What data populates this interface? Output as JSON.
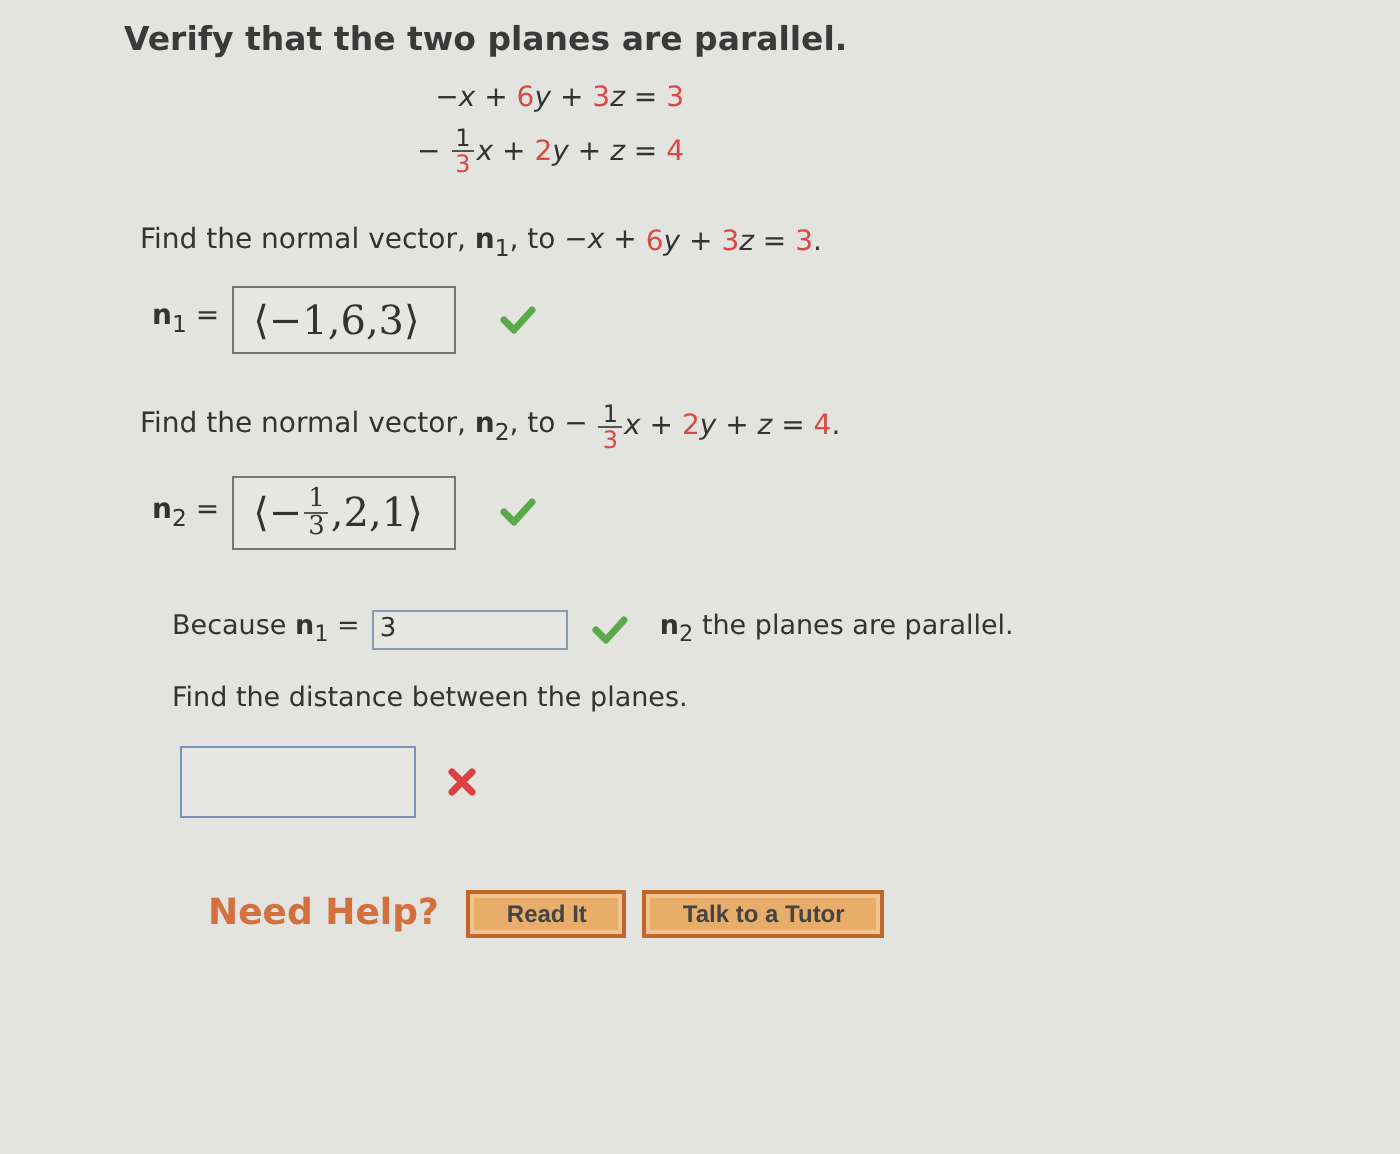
{
  "title": "Verify that the two planes are parallel.",
  "equations": [
    {
      "segments": [
        {
          "kind": "text",
          "text": "−*x* + ",
          "given": false
        },
        {
          "kind": "text",
          "text": "6",
          "given": true
        },
        {
          "kind": "text",
          "text": "*y* + ",
          "given": false
        },
        {
          "kind": "text",
          "text": "3",
          "given": true
        },
        {
          "kind": "text",
          "text": "*z* = ",
          "given": false
        },
        {
          "kind": "text",
          "text": "3",
          "given": true
        }
      ]
    },
    {
      "segments": [
        {
          "kind": "text",
          "text": "− ",
          "given": false
        },
        {
          "kind": "frac",
          "num": "1",
          "den": "3",
          "given": true
        },
        {
          "kind": "text",
          "text": "*x* + ",
          "given": false
        },
        {
          "kind": "text",
          "text": "2",
          "given": true
        },
        {
          "kind": "text",
          "text": "*y* + *z* = ",
          "given": false
        },
        {
          "kind": "text",
          "text": "4",
          "given": true
        }
      ]
    }
  ],
  "questions": [
    {
      "kind": "vector",
      "prompt": [
        {
          "kind": "text",
          "text": "Find the normal vector, **n**$_{1}$, to −*x* + ",
          "given": false
        },
        {
          "kind": "text",
          "text": "6",
          "given": true
        },
        {
          "kind": "text",
          "text": "*y* + ",
          "given": false
        },
        {
          "kind": "text",
          "text": "3",
          "given": true
        },
        {
          "kind": "text",
          "text": "*z* = ",
          "given": false
        },
        {
          "kind": "text",
          "text": "3",
          "given": true
        },
        {
          "kind": "text",
          "text": ".",
          "given": false
        }
      ],
      "label": "**n**$_{1}$ =",
      "answer": [
        {
          "kind": "text",
          "text": "⟨−1,6,3⟩",
          "given": false
        }
      ],
      "correct": true
    },
    {
      "kind": "vector",
      "prompt": [
        {
          "kind": "text",
          "text": "Find the normal vector, **n**$_{2}$, to − ",
          "given": false
        },
        {
          "kind": "frac",
          "num": "1",
          "den": "3",
          "given": true
        },
        {
          "kind": "text",
          "text": "*x* + ",
          "given": false
        },
        {
          "kind": "text",
          "text": "2",
          "given": true
        },
        {
          "kind": "text",
          "text": "*y* + *z* = ",
          "given": false
        },
        {
          "kind": "text",
          "text": "4",
          "given": true
        },
        {
          "kind": "text",
          "text": ".",
          "given": false
        }
      ],
      "label": "**n**$_{2}$ =",
      "answer": [
        {
          "kind": "text",
          "text": "⟨−",
          "given": false
        },
        {
          "kind": "frac",
          "num": "1",
          "den": "3",
          "given": false
        },
        {
          "kind": "text",
          "text": ",2,1⟩",
          "given": false
        }
      ],
      "correct": true
    },
    {
      "kind": "inline",
      "before": "Because **n**$_{1}$ =",
      "value": "3",
      "correct": true,
      "after": "**n**$_{2}$ the planes are parallel."
    },
    {
      "kind": "blank",
      "prompt": [
        {
          "kind": "text",
          "text": "Find the distance between the planes.",
          "given": false
        }
      ],
      "correct": false
    }
  ],
  "help": {
    "label": "Need Help?",
    "buttons": [
      "Read It",
      "Talk to a Tutor"
    ]
  }
}
